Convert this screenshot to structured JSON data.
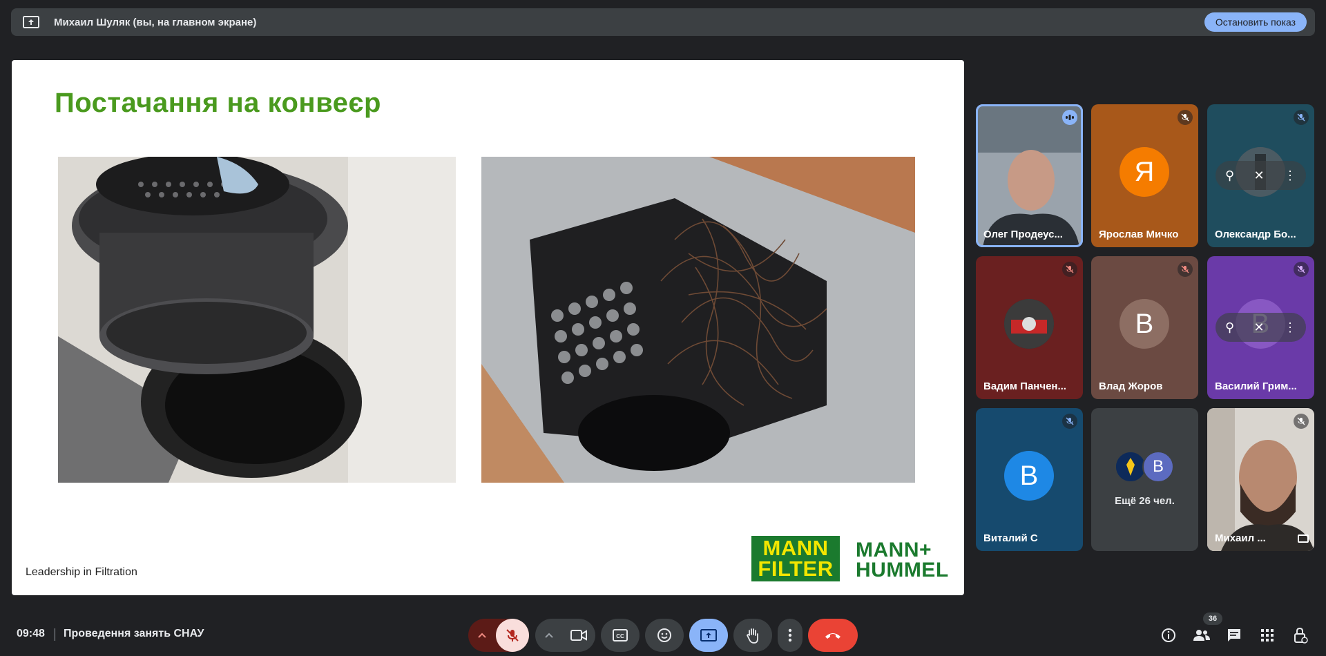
{
  "presenting_bar": {
    "text": "Михаил Шуляк (вы, на главном экране)",
    "stop_label": "Остановить показ"
  },
  "slide": {
    "title": "Постачання на конвеєр",
    "footer": "Leadership in Filtration",
    "logo_mann_filter": [
      "MANN",
      "FILTER"
    ],
    "logo_mann_hummel": [
      "MANN+",
      "HUMMEL"
    ]
  },
  "participants": [
    {
      "name": "Олег Продеус...",
      "kind": "video",
      "bg": "#7b8794",
      "speaking": true
    },
    {
      "name": "Ярослав Мичко",
      "kind": "avatar",
      "letter": "Я",
      "avatar_color": "#f57c00",
      "bg": "#a8581a",
      "muted": true
    },
    {
      "name": "Олександр Бо...",
      "kind": "photo-avatar",
      "bg": "#1f4d5e",
      "muted": true
    },
    {
      "name": "Вадим Панчен...",
      "kind": "photo-avatar",
      "bg": "#6a2020",
      "muted": true
    },
    {
      "name": "Влад Жоров",
      "kind": "avatar",
      "letter": "В",
      "avatar_color": "#8d6e63",
      "bg": "#6b4a42",
      "muted": true
    },
    {
      "name": "Василий Грим...",
      "kind": "avatar",
      "letter": "В",
      "avatar_color": "#9c6dd6",
      "bg": "#6a3aa8",
      "muted": true
    },
    {
      "name": "Виталий С",
      "kind": "avatar",
      "letter": "В",
      "avatar_color": "#1e88e5",
      "bg": "#164a6e",
      "muted": true
    },
    {
      "name": "Ещё 26 чел.",
      "kind": "more",
      "bg": "#3c4043"
    },
    {
      "name": "Михаил ...",
      "kind": "video",
      "bg": "#d8d4cf",
      "muted": true
    }
  ],
  "more_avatar_letter": "В",
  "bottom_bar": {
    "time": "09:48",
    "meeting": "Проведення занять СНАУ",
    "participants_count": "36"
  },
  "icons": {
    "present": "present-to-all-icon",
    "mic": "mic-off-icon",
    "camera": "camera-icon",
    "captions": "closed-captions-icon",
    "emoji": "emoji-icon",
    "share": "present-screen-icon",
    "hand": "raise-hand-icon",
    "more": "more-vert-icon",
    "hangup": "call-end-icon",
    "info": "info-icon",
    "people": "people-icon",
    "chat": "chat-icon",
    "activities": "apps-grid-icon",
    "lock": "host-controls-icon"
  },
  "colors": {
    "title_green": "#4a9a1e",
    "accent_blue": "#8ab4f8",
    "hangup_red": "#ea4335",
    "mic_off_bg": "#f9dedc"
  }
}
